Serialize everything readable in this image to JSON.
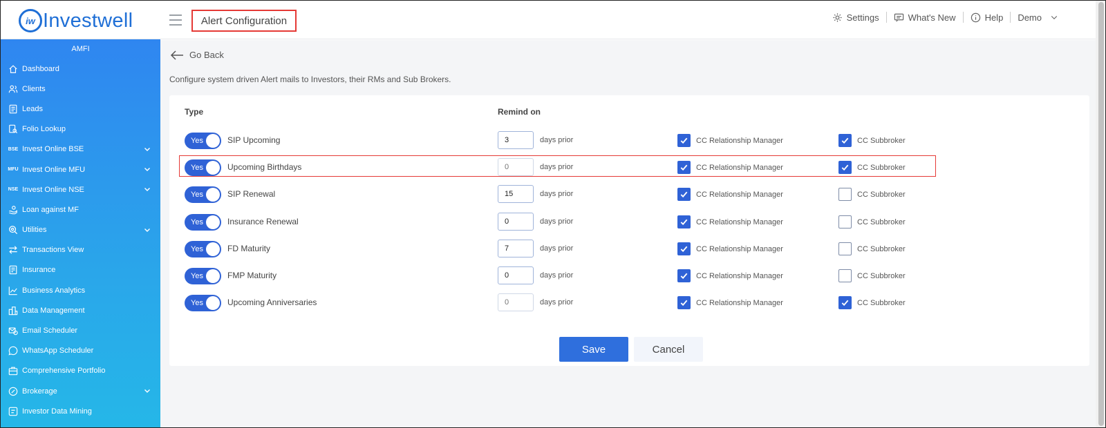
{
  "app": {
    "brand": "Investwell",
    "brand_mark": "iw",
    "page_title": "Alert Configuration"
  },
  "top_nav": {
    "settings": "Settings",
    "whats_new": "What's New",
    "help": "Help",
    "user": "Demo"
  },
  "sidebar": {
    "org": "AMFI",
    "items": [
      {
        "label": "Dashboard",
        "icon": "home-icon",
        "has_chevron": false
      },
      {
        "label": "Clients",
        "icon": "users-icon",
        "has_chevron": false
      },
      {
        "label": "Leads",
        "icon": "leads-icon",
        "has_chevron": false
      },
      {
        "label": "Folio Lookup",
        "icon": "folio-lookup-icon",
        "has_chevron": false
      },
      {
        "label": "Invest Online BSE",
        "icon": "bse-icon",
        "icon_text": "BSE",
        "has_chevron": true
      },
      {
        "label": "Invest Online MFU",
        "icon": "mfu-icon",
        "icon_text": "MFU",
        "has_chevron": true
      },
      {
        "label": "Invest Online NSE",
        "icon": "nse-icon",
        "icon_text": "NSE",
        "has_chevron": true
      },
      {
        "label": "Loan against MF",
        "icon": "loan-icon",
        "has_chevron": false
      },
      {
        "label": "Utilities",
        "icon": "utilities-icon",
        "has_chevron": true
      },
      {
        "label": "Transactions View",
        "icon": "transactions-icon",
        "has_chevron": false
      },
      {
        "label": "Insurance",
        "icon": "insurance-icon",
        "has_chevron": false
      },
      {
        "label": "Business Analytics",
        "icon": "analytics-icon",
        "has_chevron": false
      },
      {
        "label": "Data Management",
        "icon": "data-management-icon",
        "has_chevron": false
      },
      {
        "label": "Email Scheduler",
        "icon": "email-scheduler-icon",
        "has_chevron": false
      },
      {
        "label": "WhatsApp Scheduler",
        "icon": "whatsapp-icon",
        "has_chevron": false
      },
      {
        "label": "Comprehensive Portfolio",
        "icon": "portfolio-icon",
        "has_chevron": false
      },
      {
        "label": "Brokerage",
        "icon": "brokerage-icon",
        "has_chevron": true
      },
      {
        "label": "Investor Data Mining",
        "icon": "data-mining-icon",
        "has_chevron": false
      }
    ]
  },
  "main": {
    "go_back": "Go Back",
    "description": "Configure system driven Alert mails to Investors, their RMs and Sub Brokers.",
    "columns": {
      "type": "Type",
      "remind_on": "Remind on"
    },
    "days_suffix": "days prior",
    "cc_rm_label": "CC Relationship Manager",
    "cc_sb_label": "CC Subbroker",
    "toggle_label": "Yes",
    "rows": [
      {
        "name": "SIP Upcoming",
        "enabled": true,
        "days": "3",
        "days_placeholder": "",
        "cc_rm": true,
        "cc_sb": true
      },
      {
        "name": "Upcoming Birthdays",
        "enabled": true,
        "days": "",
        "days_placeholder": "0",
        "cc_rm": true,
        "cc_sb": true
      },
      {
        "name": "SIP Renewal",
        "enabled": true,
        "days": "15",
        "days_placeholder": "",
        "cc_rm": true,
        "cc_sb": false
      },
      {
        "name": "Insurance Renewal",
        "enabled": true,
        "days": "0",
        "days_placeholder": "",
        "cc_rm": true,
        "cc_sb": false
      },
      {
        "name": "FD Maturity",
        "enabled": true,
        "days": "7",
        "days_placeholder": "",
        "cc_rm": true,
        "cc_sb": false
      },
      {
        "name": "FMP Maturity",
        "enabled": true,
        "days": "0",
        "days_placeholder": "",
        "cc_rm": true,
        "cc_sb": false
      },
      {
        "name": "Upcoming Anniversaries",
        "enabled": true,
        "days": "",
        "days_placeholder": "0",
        "cc_rm": true,
        "cc_sb": true
      }
    ],
    "save_label": "Save",
    "cancel_label": "Cancel"
  },
  "colors": {
    "accent": "#2f62d6",
    "sidebar_top": "#2f86f0",
    "sidebar_bottom": "#25b7e8",
    "highlight": "#e53935"
  }
}
